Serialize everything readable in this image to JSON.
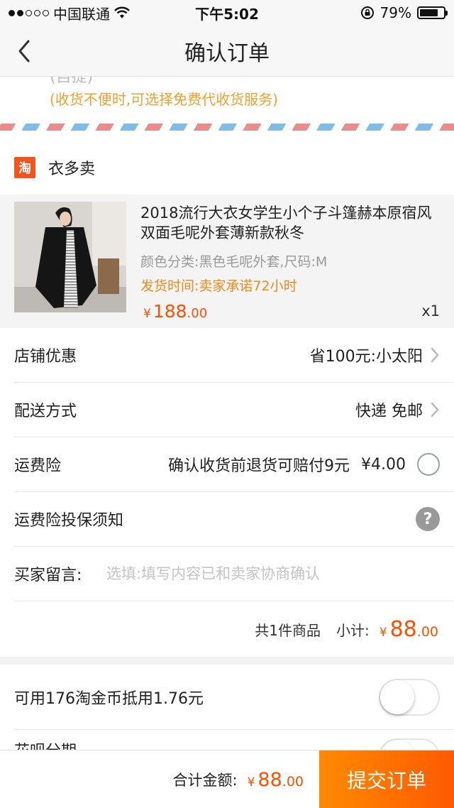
{
  "status_bar": {
    "carrier": "中国联通",
    "time": "下午5:02",
    "battery_percent": "79%",
    "battery_level": 0.79,
    "signal_icon": "signal-dots-icon",
    "wifi_icon": "wifi-icon",
    "lock_icon": "rotation-lock-icon"
  },
  "nav": {
    "title": "确认订单",
    "back_icon": "chevron-left-icon"
  },
  "address": {
    "hidden_text": "(自提)",
    "note": "(收货不便时,可选择免费代收货服务)"
  },
  "shop": {
    "icon_text": "淘",
    "name": "衣多卖"
  },
  "product": {
    "title": "2018流行大衣女学生小个子斗篷赫本原宿风双面毛呢外套薄新款秋冬",
    "sku": "颜色分类:黑色毛呢外套,尺码:M",
    "shipping": "发货时间:卖家承诺72小时",
    "price_symbol": "¥",
    "price_int": "188",
    "price_dec": ".00",
    "quantity": "x1"
  },
  "rows": {
    "discount": {
      "label": "店铺优惠",
      "value": "省100元:小太阳"
    },
    "delivery": {
      "label": "配送方式",
      "value": "快递 免邮"
    },
    "insurance": {
      "label": "运费险",
      "value": "确认收货前退货可赔付9元",
      "price": "¥4.00"
    },
    "insurance_notice": {
      "label": "运费险投保须知",
      "icon_text": "?"
    },
    "message": {
      "label": "买家留言:",
      "placeholder": "选填:填写内容已和卖家协商确认"
    }
  },
  "subtotal": {
    "count_text": "共1件商品",
    "label": "小计:",
    "symbol": "¥",
    "int": "88",
    "dec": ".00"
  },
  "coins": {
    "label": "可用176淘金币抵用1.76元",
    "second_label": "花呗分期"
  },
  "footer": {
    "total_label": "合计金额:",
    "symbol": "¥",
    "int": "88",
    "dec": ".00",
    "submit": "提交订单"
  },
  "colors": {
    "accent": "#ff5000",
    "shipping_text": "#f08a1c",
    "note_text": "#f0a030",
    "submit_start": "#ff8a00",
    "submit_end": "#ff5a00"
  }
}
